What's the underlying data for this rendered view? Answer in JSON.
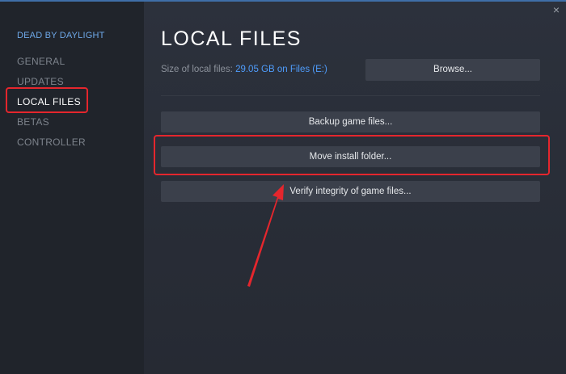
{
  "window": {
    "close_icon": "close-icon",
    "close_glyph": "×"
  },
  "sidebar": {
    "game_title": "DEAD BY DAYLIGHT",
    "items": [
      {
        "label": "GENERAL",
        "active": false
      },
      {
        "label": "UPDATES",
        "active": false
      },
      {
        "label": "LOCAL FILES",
        "active": true
      },
      {
        "label": "BETAS",
        "active": false
      },
      {
        "label": "CONTROLLER",
        "active": false
      }
    ]
  },
  "main": {
    "title": "LOCAL FILES",
    "size_label": "Size of local files:",
    "size_value": "29.05 GB on Files (E:)",
    "browse_label": "Browse...",
    "backup_label": "Backup game files...",
    "move_label": "Move install folder...",
    "verify_label": "Verify integrity of game files..."
  },
  "colors": {
    "accent": "#6ea8e8",
    "link": "#4f9dfc",
    "annotation": "#e5262d"
  }
}
